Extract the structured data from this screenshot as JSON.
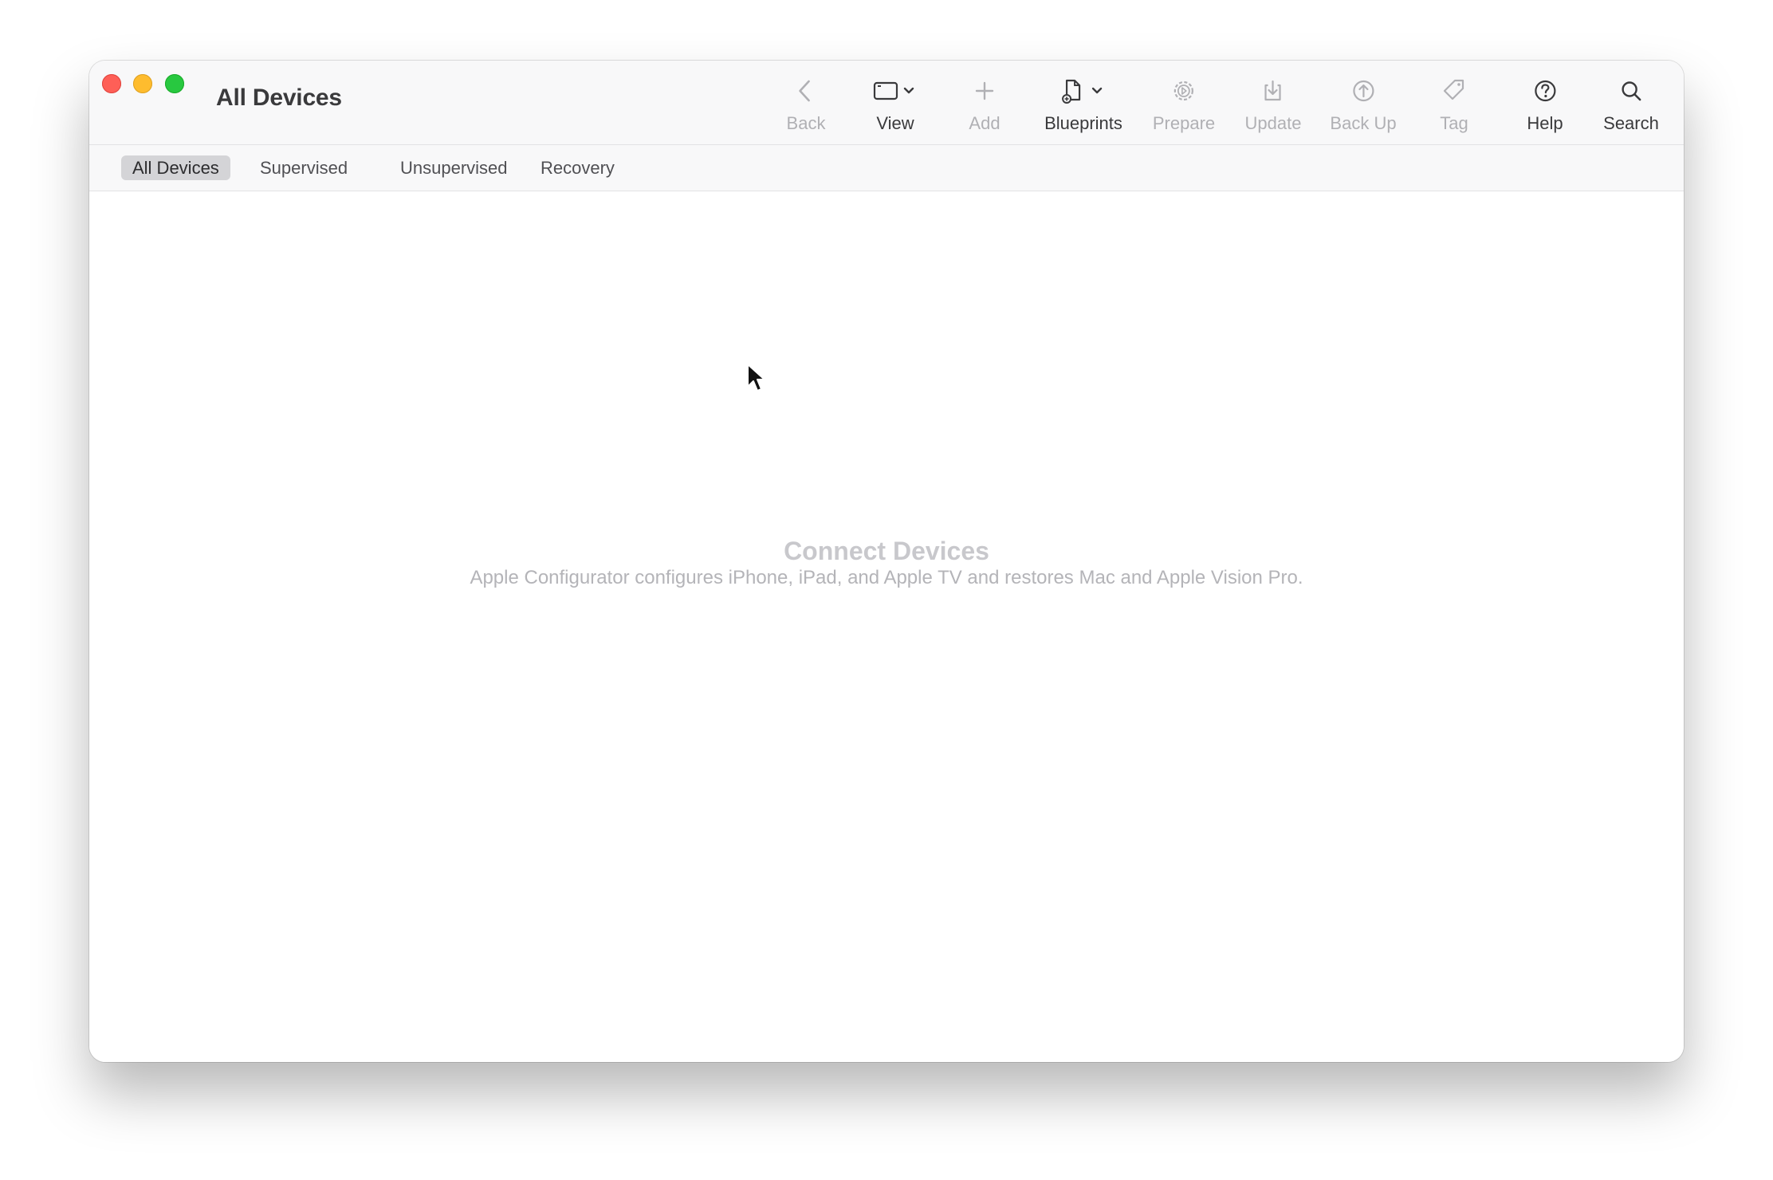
{
  "window": {
    "title": "All Devices"
  },
  "toolbar": {
    "items": [
      {
        "label": "Back",
        "icon": "chevron-left-icon",
        "enabled": false
      },
      {
        "label": "View",
        "icon": "window-view-icon",
        "enabled": true
      },
      {
        "label": "Add",
        "icon": "plus-icon",
        "enabled": false
      },
      {
        "label": "Blueprints",
        "icon": "blueprint-document-icon",
        "enabled": true
      },
      {
        "label": "Prepare",
        "icon": "gear-icon",
        "enabled": false
      },
      {
        "label": "Update",
        "icon": "download-tray-icon",
        "enabled": false
      },
      {
        "label": "Back Up",
        "icon": "upload-circle-icon",
        "enabled": false
      },
      {
        "label": "Tag",
        "icon": "tag-icon",
        "enabled": false
      },
      {
        "label": "Help",
        "icon": "question-circle-icon",
        "enabled": true
      },
      {
        "label": "Search",
        "icon": "magnifier-icon",
        "enabled": true
      }
    ]
  },
  "scope_bar": {
    "tabs": [
      {
        "label": "All Devices",
        "selected": true
      },
      {
        "label": "Supervised",
        "selected": false
      },
      {
        "label": "Unsupervised",
        "selected": false
      },
      {
        "label": "Recovery",
        "selected": false
      }
    ]
  },
  "empty_state": {
    "title": "Connect Devices",
    "subtitle": "Apple Configurator configures iPhone, iPad, and Apple TV and restores Mac and Apple Vision Pro."
  },
  "colors": {
    "close": "#fe5f57",
    "minimize": "#febc2e",
    "zoom": "#28c840",
    "enabled_text": "#3a3a3c",
    "disabled_text": "#b0b0b4",
    "selected_tab_bg": "#d4d4d7"
  }
}
